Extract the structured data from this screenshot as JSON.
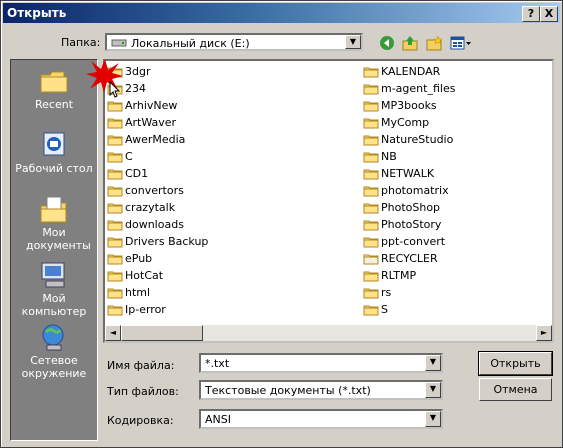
{
  "window": {
    "title": "Открыть",
    "help_btn": "?",
    "close_btn": "X"
  },
  "toolbar": {
    "lookin_label": "Папка:",
    "lookin_value": "Локальный диск (E:)",
    "icons": [
      "back-icon",
      "up-folder-icon",
      "new-folder-icon",
      "view-menu-icon"
    ]
  },
  "places": [
    {
      "label": "Recent",
      "icon": "recent-icon"
    },
    {
      "label": "Рабочий стол",
      "icon": "desktop-icon"
    },
    {
      "label": "Мои документы",
      "icon": "my-documents-icon"
    },
    {
      "label": "Мой компьютер",
      "icon": "my-computer-icon"
    },
    {
      "label": "Сетевое окружение",
      "icon": "network-icon"
    }
  ],
  "files_col1": [
    "3dgr",
    "234",
    "ArhivNew",
    "ArtWaver",
    "AwerMedia",
    "C",
    "CD1",
    "convertors",
    "crazytalk",
    "downloads",
    "Drivers Backup",
    "ePub",
    "HotCat",
    "html",
    "Ip-error"
  ],
  "files_col2": [
    "KALENDAR",
    "m-agent_files",
    "MP3books",
    "MyComp",
    "NatureStudio",
    "NB",
    "NETWALK",
    "photomatrix",
    "PhotoShop",
    "PhotoStory",
    "ppt-convert",
    "RECYCLER",
    "RLTMP",
    "rs",
    "S"
  ],
  "form": {
    "filename_label": "Имя файла:",
    "filename_value": "*.txt",
    "filetype_label": "Тип файлов:",
    "filetype_value": "Текстовые документы (*.txt)",
    "encoding_label": "Кодировка:",
    "encoding_value": "ANSI"
  },
  "buttons": {
    "open": "Открыть",
    "cancel": "Отмена"
  }
}
